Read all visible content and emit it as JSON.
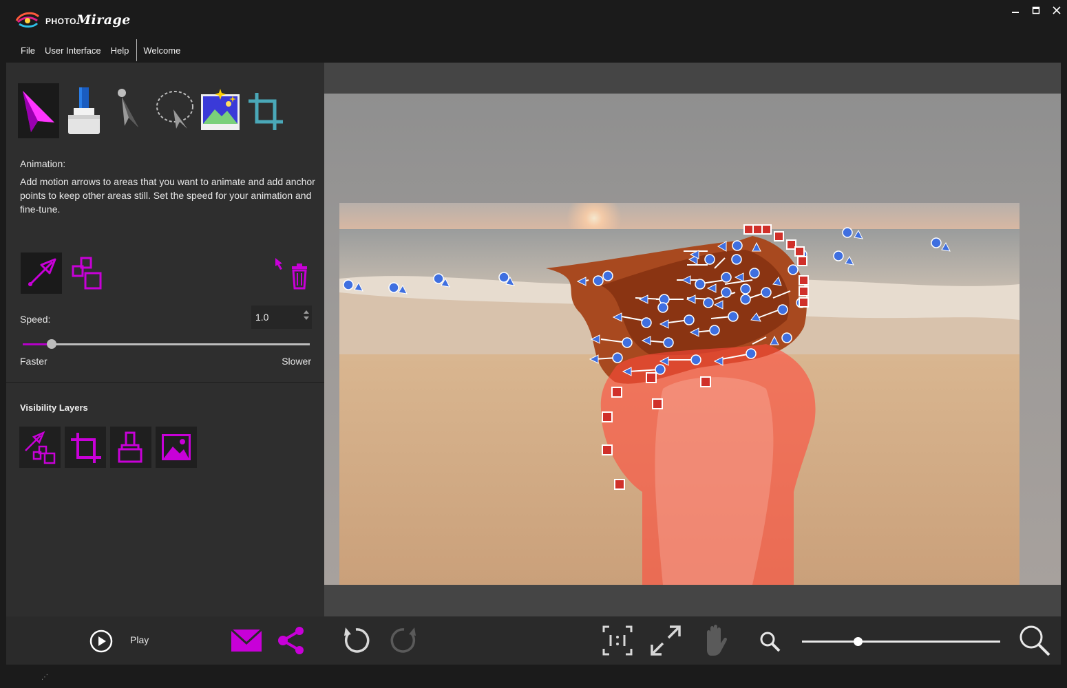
{
  "app": {
    "logo_prefix": "PHOTO",
    "logo_name": "Mirage",
    "window_controls": [
      "minimize",
      "maximize",
      "close"
    ]
  },
  "menu": {
    "items": [
      "File",
      "User Interface",
      "Help"
    ],
    "tab": "Welcome"
  },
  "tools": {
    "names": [
      "animate-tool",
      "mask-tool",
      "select-tool",
      "lasso-tool",
      "overlay-tool",
      "crop-tool"
    ],
    "active": "animate-tool"
  },
  "animation": {
    "heading": "Animation:",
    "description": "Add motion arrows to areas that you want to animate and add anchor points to keep other areas still. Set the speed for your animation and fine-tune.",
    "sub_tools": [
      "motion-arrow-tool",
      "anchor-point-tool"
    ],
    "active_sub_tool": "motion-arrow-tool"
  },
  "speed": {
    "label": "Speed:",
    "value": "1.0",
    "slider_fraction": 0.1,
    "min_label": "Faster",
    "max_label": "Slower"
  },
  "visibility": {
    "heading": "Visibility Layers",
    "layers": [
      "arrows-anchors-layer",
      "crop-layer",
      "mask-layer",
      "image-layer"
    ]
  },
  "bottom": {
    "play_label": "Play",
    "zoom_fraction": 0.28
  },
  "colors": {
    "accent": "#b400c8",
    "arrow": "#3f6fe0",
    "anchor": "#d0302a",
    "mask": "#ff4a3a"
  }
}
